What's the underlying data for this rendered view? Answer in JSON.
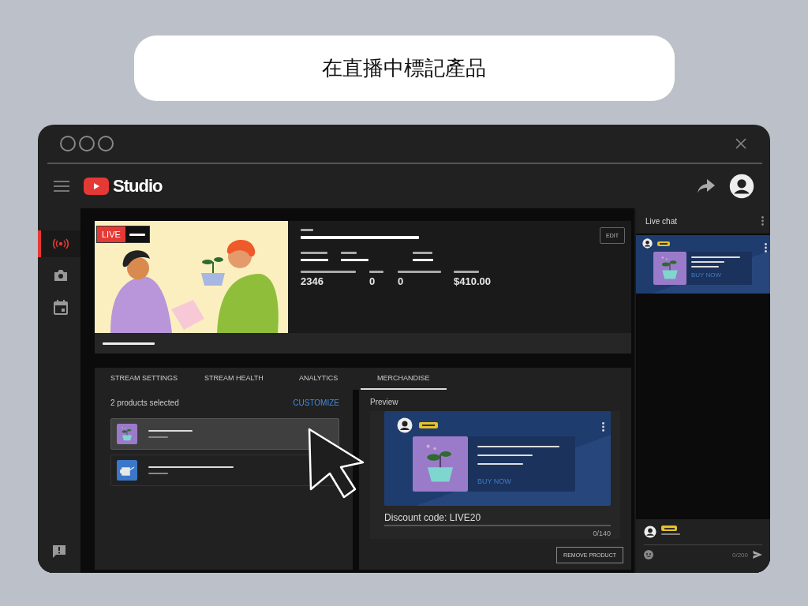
{
  "banner": {
    "title": "在直播中標記產品"
  },
  "header": {
    "logo_text": "Studio"
  },
  "sidebar": {
    "items": [
      {
        "kind": "live",
        "selected": true
      },
      {
        "kind": "camera",
        "selected": false
      },
      {
        "kind": "calendar",
        "selected": false
      }
    ]
  },
  "video": {
    "live_badge": "LIVE",
    "stats": [
      "2346",
      "0",
      "0",
      "$410.00"
    ],
    "edit_button": "EDIT"
  },
  "tabs": [
    {
      "label": "STREAM SETTINGS",
      "selected": false
    },
    {
      "label": "STREAM HEALTH",
      "selected": false
    },
    {
      "label": "ANALYTICS",
      "selected": false
    },
    {
      "label": "MERCHANDISE",
      "selected": true
    }
  ],
  "products": {
    "summary": "2 products selected",
    "customize": "CUSTOMIZE",
    "items": [
      {
        "kind": "plant",
        "selected": true
      },
      {
        "kind": "watering-can",
        "selected": false
      }
    ]
  },
  "preview": {
    "title": "Preview",
    "buy_button": "BUY NOW",
    "discount_value": "Discount code: LIVE20",
    "counter": "0/140",
    "remove_button": "REMOVE PRODUCT"
  },
  "live_chat": {
    "title": "Live chat",
    "buy_button": "BUY NOW",
    "counter": "0/200"
  }
}
